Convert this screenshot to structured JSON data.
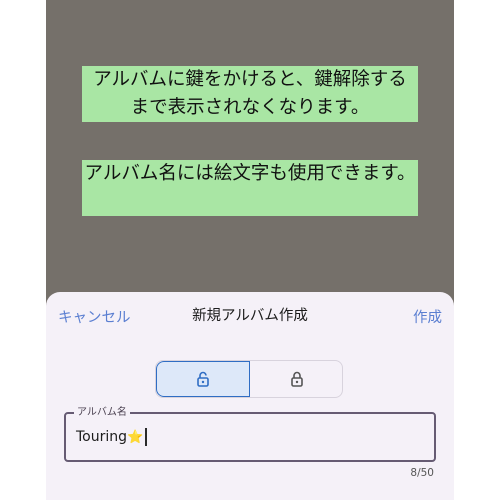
{
  "hints": {
    "lock_hint": "アルバムに鍵をかけると、鍵解除するまで表示されなくなります。",
    "emoji_hint": "アルバム名には絵文字も使用できます。"
  },
  "sheet": {
    "cancel_label": "キャンセル",
    "title": "新規アルバム作成",
    "create_label": "作成",
    "lock_toggle": {
      "options": [
        {
          "icon": "unlock-icon",
          "selected": true
        },
        {
          "icon": "lock-icon",
          "selected": false
        }
      ]
    },
    "album_name": {
      "label": "アルバム名",
      "value": "Touring",
      "emoji": "⭐",
      "counter": "8/50"
    }
  },
  "colors": {
    "accent": "#5b7fd1",
    "selected_segment_border": "#2f6dc4",
    "hint_background": "#a9e6a4",
    "backdrop": "#75706a"
  }
}
